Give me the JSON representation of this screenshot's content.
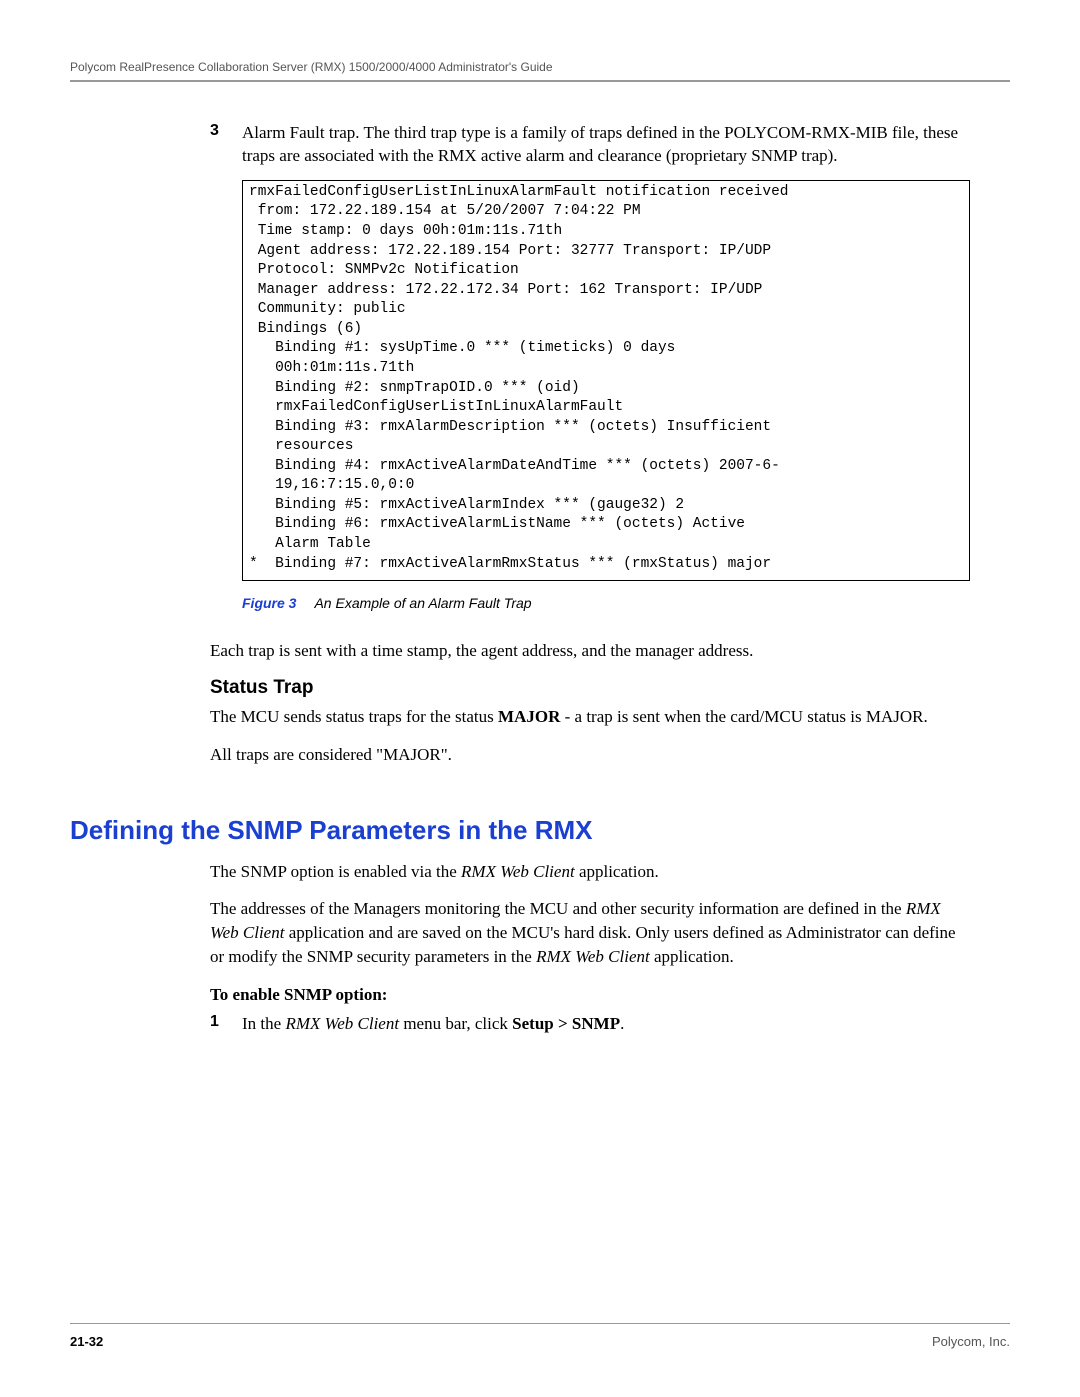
{
  "header": "Polycom RealPresence Collaboration Server (RMX) 1500/2000/4000 Administrator's Guide",
  "item3": {
    "num": "3",
    "text": "Alarm Fault trap. The third trap type is a family of traps defined in the POLYCOM-RMX-MIB file, these traps are associated with the RMX active alarm and clearance (proprietary SNMP trap)."
  },
  "code_block": "rmxFailedConfigUserListInLinuxAlarmFault notification received\n from: 172.22.189.154 at 5/20/2007 7:04:22 PM\n Time stamp: 0 days 00h:01m:11s.71th\n Agent address: 172.22.189.154 Port: 32777 Transport: IP/UDP\n Protocol: SNMPv2c Notification\n Manager address: 172.22.172.34 Port: 162 Transport: IP/UDP\n Community: public\n Bindings (6)\n   Binding #1: sysUpTime.0 *** (timeticks) 0 days\n   00h:01m:11s.71th\n   Binding #2: snmpTrapOID.0 *** (oid)\n   rmxFailedConfigUserListInLinuxAlarmFault\n   Binding #3: rmxAlarmDescription *** (octets) Insufficient\n   resources\n   Binding #4: rmxActiveAlarmDateAndTime *** (octets) 2007-6-\n   19,16:7:15.0,0:0\n   Binding #5: rmxActiveAlarmIndex *** (gauge32) 2\n   Binding #6: rmxActiveAlarmListName *** (octets) Active\n   Alarm Table\n*  Binding #7: rmxActiveAlarmRmxStatus *** (rmxStatus) major",
  "figure": {
    "label": "Figure 3",
    "caption": "An Example of an Alarm Fault Trap"
  },
  "para_each_trap": "Each trap is sent with a time stamp, the agent address, and the manager address.",
  "status_trap_heading": "Status Trap",
  "status_trap_p1_a": "The MCU sends status traps for the status ",
  "status_trap_p1_bold": "MAJOR",
  "status_trap_p1_b": " - a trap is sent when the card/MCU status is MAJOR.",
  "status_trap_p2": "All traps are considered \"MAJOR\".",
  "section_heading": "Defining the SNMP Parameters in the RMX",
  "snmp_p1_a": "The SNMP option is enabled via the ",
  "snmp_p1_i": "RMX Web Client",
  "snmp_p1_b": " application.",
  "snmp_p2_a": "The addresses of the Managers monitoring the MCU and other security information are defined in the ",
  "snmp_p2_i1": "RMX Web Client",
  "snmp_p2_b": " application and are saved on the MCU's hard disk. Only users defined as Administrator can define or modify the SNMP security parameters in the ",
  "snmp_p2_i2": "RMX Web Client",
  "snmp_p2_c": " application.",
  "enable_heading": "To enable SNMP option:",
  "step1": {
    "num": "1",
    "a": "In the ",
    "i": "RMX Web Client",
    "b": " menu bar, click ",
    "bold": "Setup > SNMP",
    "c": "."
  },
  "footer": {
    "page": "21-32",
    "company": "Polycom, Inc."
  }
}
